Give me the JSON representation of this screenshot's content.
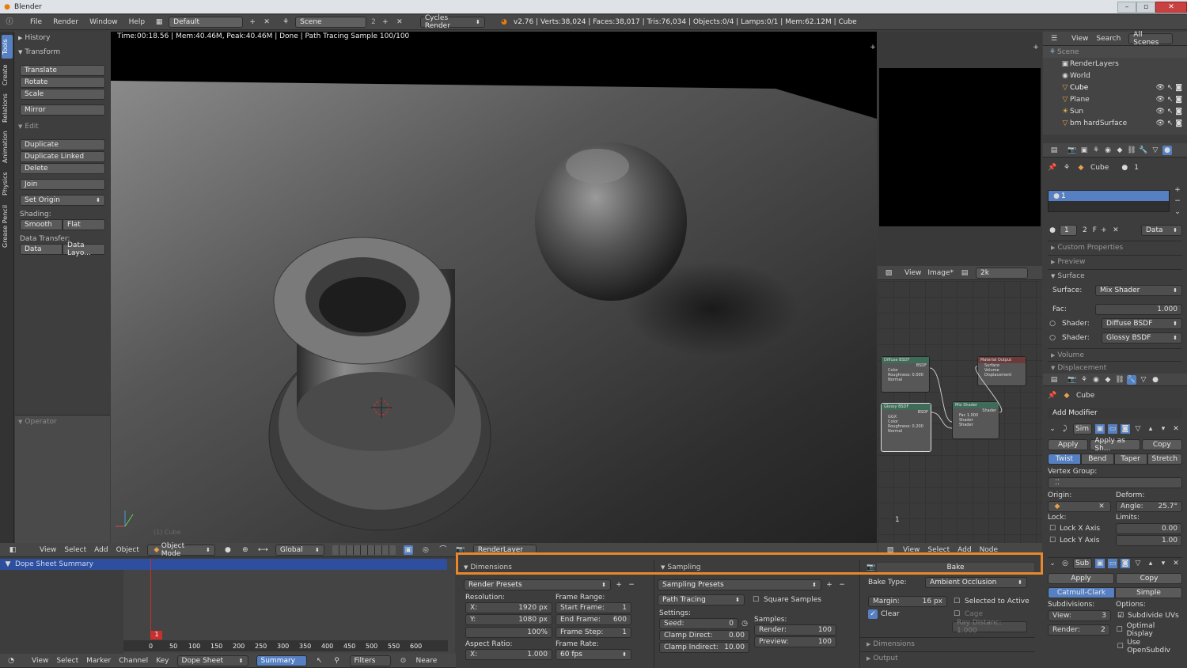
{
  "window": {
    "title": "Blender"
  },
  "infobar": {
    "menus": [
      "File",
      "Render",
      "Window",
      "Help"
    ],
    "layout": "Default",
    "scene": "Scene",
    "scene_users": "2",
    "engine": "Cycles Render",
    "stats": "v2.76 | Verts:38,024 | Faces:38,017 | Tris:76,034 | Objects:0/4 | Lamps:0/1 | Mem:62.12M | Cube"
  },
  "vtabs": [
    "Tools",
    "Create",
    "Relations",
    "Animation",
    "Physics",
    "Grease Pencil"
  ],
  "toolshelf": {
    "history": "History",
    "transform": "Transform",
    "translate": "Translate",
    "rotate": "Rotate",
    "scale": "Scale",
    "mirror": "Mirror",
    "edit": "Edit",
    "duplicate": "Duplicate",
    "duplicate_linked": "Duplicate Linked",
    "delete": "Delete",
    "join": "Join",
    "set_origin": "Set Origin",
    "shading_label": "Shading:",
    "smooth": "Smooth",
    "flat": "Flat",
    "data_transfer_label": "Data Transfer:",
    "data": "Data",
    "data_layout": "Data Layo...",
    "operator": "Operator"
  },
  "viewport": {
    "render_info": "Time:00:18.56 | Mem:40.46M, Peak:40.46M | Done | Path Tracing Sample 100/100",
    "object_label": "(1) Cube",
    "header": {
      "view": "View",
      "select": "Select",
      "add": "Add",
      "object": "Object",
      "mode": "Object Mode",
      "orientation": "Global",
      "render_layer": "RenderLayer"
    }
  },
  "image_editor": {
    "view": "View",
    "image": "Image*",
    "resolution": "2k"
  },
  "node_editor": {
    "frame": "1",
    "nodes": [
      {
        "title": "Diffuse BSDF",
        "lines": [
          "BSDF",
          "Color",
          "Roughness: 0.000",
          "Normal"
        ]
      },
      {
        "title": "Glossy BSDF",
        "lines": [
          "BSDF",
          "GGX",
          "Color",
          "Roughness: 0.200",
          "Normal"
        ]
      },
      {
        "title": "Mix Shader",
        "lines": [
          "Shader",
          "Fac 1.000",
          "Shader",
          "Shader"
        ]
      },
      {
        "title": "Material Output",
        "lines": [
          "Surface",
          "Volume",
          "Displacement"
        ]
      }
    ],
    "header": {
      "view": "View",
      "select": "Select",
      "add": "Add",
      "node": "Node"
    }
  },
  "outliner": {
    "view": "View",
    "search": "Search",
    "all_scenes": "All Scenes",
    "items": [
      {
        "label": "Scene",
        "depth": 0
      },
      {
        "label": "RenderLayers",
        "depth": 1
      },
      {
        "label": "World",
        "depth": 1
      },
      {
        "label": "Cube",
        "depth": 1
      },
      {
        "label": "Plane",
        "depth": 1
      },
      {
        "label": "Sun",
        "depth": 1
      },
      {
        "label": "bm hardSurface",
        "depth": 1
      }
    ]
  },
  "material": {
    "object": "Cube",
    "users": "1",
    "slot": "1",
    "mat_index": "1",
    "mat_users": "2",
    "fake_user": "F",
    "link": "Data",
    "custom_properties": "Custom Properties",
    "preview": "Preview",
    "surface": "Surface",
    "surface_label": "Surface:",
    "surface_value": "Mix Shader",
    "fac_label": "Fac:",
    "fac_value": "1.000",
    "shader_label": "Shader:",
    "shader1": "Diffuse BSDF",
    "shader2": "Glossy BSDF",
    "volume": "Volume",
    "displacement": "Displacement"
  },
  "modifiers": {
    "object": "Cube",
    "add_modifier": "Add Modifier",
    "simple_deform": {
      "short": "Sim",
      "apply": "Apply",
      "apply_shape": "Apply as Sh...",
      "copy": "Copy",
      "modes": [
        "Twist",
        "Bend",
        "Taper",
        "Stretch"
      ],
      "active_mode": "Twist",
      "vertex_group": "Vertex Group:",
      "origin": "Origin:",
      "deform": "Deform:",
      "angle_label": "Angle:",
      "angle": "25.7°",
      "lock": "Lock:",
      "limits": "Limits:",
      "lock_x": "Lock X Axis",
      "lock_y": "Lock Y Axis",
      "limit_min": "0.00",
      "limit_max": "1.00"
    },
    "subsurf": {
      "short": "Sub",
      "apply": "Apply",
      "copy": "Copy",
      "catmull": "Catmull-Clark",
      "simple": "Simple",
      "subdivisions": "Subdivisions:",
      "options": "Options:",
      "view_label": "View:",
      "view": "3",
      "render_label": "Render:",
      "render": "2",
      "subdivide_uvs": "Subdivide UVs",
      "optimal_display": "Optimal Display",
      "use_opensubdiv": "Use OpenSubdiv"
    }
  },
  "timeline": {
    "dope_summary": "Dope Sheet Summary",
    "ticks": [
      "0",
      "50",
      "100",
      "150",
      "200",
      "250",
      "300",
      "350",
      "400",
      "450",
      "500",
      "550",
      "600"
    ],
    "current_frame": "1",
    "header": {
      "view": "View",
      "select": "Select",
      "marker": "Marker",
      "channel": "Channel",
      "key": "Key",
      "mode": "Dope Sheet",
      "summary": "Summary",
      "filters": "Filters",
      "nearest": "Neare"
    }
  },
  "dimensions": {
    "title": "Dimensions",
    "render_presets": "Render Presets",
    "resolution": "Resolution:",
    "x_label": "X:",
    "x": "1920 px",
    "y_label": "Y:",
    "y": "1080 px",
    "pct": "100%",
    "frame_range": "Frame Range:",
    "start_label": "Start Frame:",
    "start": "1",
    "end_label": "End Frame:",
    "end": "600",
    "step_label": "Frame Step:",
    "step": "1",
    "aspect": "Aspect Ratio:",
    "ax_label": "X:",
    "ax": "1.000",
    "frame_rate": "Frame Rate:",
    "fps": "60 fps"
  },
  "sampling": {
    "title": "Sampling",
    "presets": "Sampling Presets",
    "method": "Path Tracing",
    "square": "Square Samples",
    "settings": "Settings:",
    "samples": "Samples:",
    "seed_label": "Seed:",
    "seed": "0",
    "clamp_direct_label": "Clamp Direct:",
    "clamp_direct": "0.00",
    "clamp_indirect_label": "Clamp Indirect:",
    "clamp_indirect": "10.00",
    "render_label": "Render:",
    "render": "100",
    "preview_label": "Preview:",
    "preview": "100"
  },
  "bake": {
    "title": "Bake",
    "type_label": "Bake Type:",
    "type": "Ambient Occlusion",
    "margin_label": "Margin:",
    "margin": "16 px",
    "selected_to_active": "Selected to Active",
    "clear": "Clear",
    "cage": "Cage",
    "ray_distance": "Ray Distanc: 1.000",
    "dimensions": "Dimensions",
    "output": "Output"
  },
  "colors": {
    "accent": "#5680c2",
    "highlight": "#e8882b",
    "panel": "#3d3d3d"
  }
}
